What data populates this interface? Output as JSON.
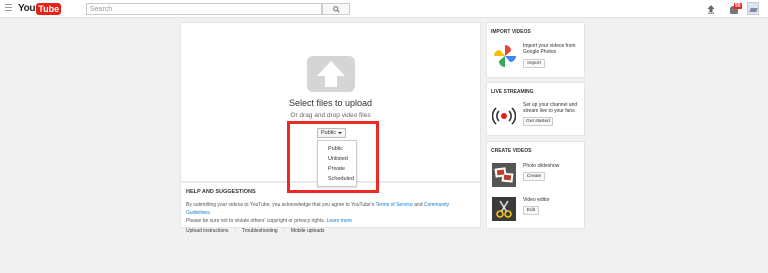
{
  "header": {
    "logo_you": "You",
    "logo_tube": "Tube",
    "search_placeholder": "Search",
    "notification_count": "99"
  },
  "upload": {
    "title": "Select files to upload",
    "drag_text": "Or drag and drop video files",
    "privacy_selected": "Public",
    "privacy_options": [
      "Public",
      "Unlisted",
      "Private",
      "Scheduled"
    ]
  },
  "help": {
    "title": "HELP AND SUGGESTIONS",
    "text_part1": "By submitting your videos to YouTube, you acknowledge that you agree to YouTube's ",
    "tos_link": "Terms of Service",
    "text_and": " and ",
    "guidelines_link": "Community Guidelines",
    "text_part2": ".",
    "text_line2": "Please be sure not to violate others' copyright or privacy rights. ",
    "learn_more": "Learn more",
    "links": [
      "Upload instructions",
      "Troubleshooting",
      "Mobile uploads"
    ]
  },
  "cards": {
    "import": {
      "title": "IMPORT VIDEOS",
      "desc": "Import your videos from Google Photos",
      "button": "Import"
    },
    "live": {
      "title": "LIVE STREAMING",
      "desc": "Set up your channel and stream live to your fans",
      "button": "Get started"
    },
    "create": {
      "title": "CREATE VIDEOS",
      "slideshow_label": "Photo slideshow",
      "slideshow_button": "Create",
      "editor_label": "Video editor",
      "editor_button": "Edit"
    }
  },
  "colors": {
    "brand_red": "#e62117",
    "highlight_red": "#ea2a24",
    "link_blue": "#167ac6"
  }
}
